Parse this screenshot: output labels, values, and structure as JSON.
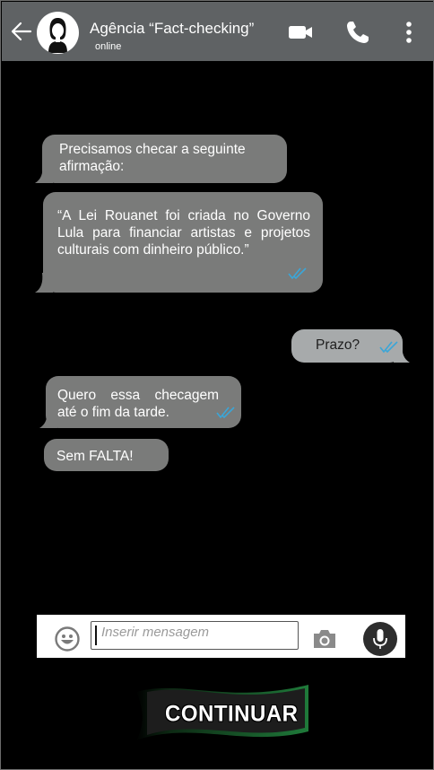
{
  "header": {
    "contact_name": "Agência “Fact-checking”",
    "status": "online"
  },
  "icons": {
    "back": "arrow-left-icon",
    "avatar": "person-avatar-icon",
    "video": "video-camera-icon",
    "call": "phone-icon",
    "menu": "kebab-menu-icon",
    "read_receipt": "double-check-icon",
    "emoji": "emoji-icon",
    "camera": "camera-icon",
    "mic": "microphone-icon"
  },
  "messages": [
    {
      "direction": "in",
      "lines": [
        "Precisamos checar a seguinte",
        "afirmação:"
      ],
      "read": false
    },
    {
      "direction": "in",
      "lines": [
        "“A Lei Rouanet foi criada no Governo",
        "Lula para financiar artistas e projetos",
        "culturais  com dinheiro público.”"
      ],
      "read": true
    },
    {
      "direction": "out",
      "lines": [
        "Prazo?"
      ],
      "read": true
    },
    {
      "direction": "in",
      "lines": [
        "Quero  essa  checagem",
        "até o fim da tarde."
      ],
      "read": true
    },
    {
      "direction": "in",
      "lines": [
        "Sem FALTA!"
      ],
      "read": false
    }
  ],
  "composer": {
    "placeholder": "Inserir mensagem"
  },
  "continue_label": "CONTINUAR",
  "colors": {
    "header": "#5f6264",
    "bubble_in": "#7a7b7a",
    "bubble_out": "#a7aaab",
    "tick": "#3aa6d8",
    "banner_green": "#1f7a3a"
  }
}
